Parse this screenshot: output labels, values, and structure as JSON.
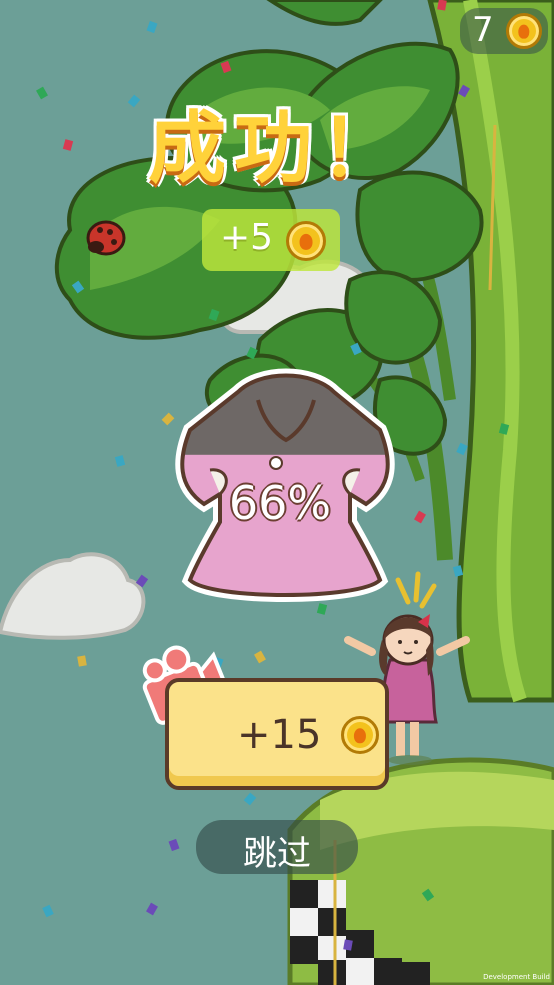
{
  "hud": {
    "coins": "7"
  },
  "result": {
    "title": "成功！",
    "reward": "+5",
    "progress_text": "66%",
    "progress": 0.66
  },
  "buttons": {
    "video_reward": "+15",
    "skip": "跳过"
  },
  "footer": {
    "build_label": "Development Build"
  },
  "colors": {
    "sky": "#6c9f97",
    "leaf": "#5aa334",
    "title": "#ffd23a",
    "dress": "#e7a4cd",
    "button": "#fbe28a"
  }
}
